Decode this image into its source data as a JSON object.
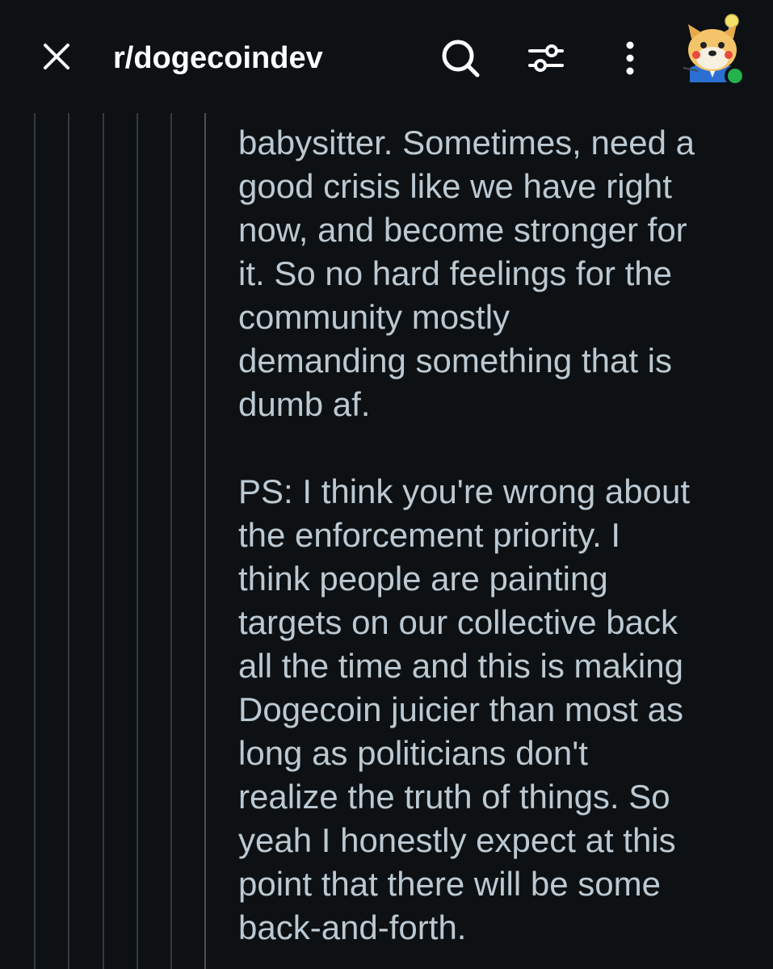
{
  "header": {
    "title": "r/dogecoindev",
    "icons": {
      "close": "close-icon",
      "search": "search-icon",
      "filter": "filter-icon",
      "more": "more-vertical-icon",
      "avatar": "avatar-image"
    },
    "online_status_color": "#24b24d"
  },
  "comment": {
    "paragraphs": [
      "babysitter. Sometimes, need a\ngood crisis like we have right\nnow, and become stronger for\nit. So no hard feelings for the\ncommunity mostly\ndemanding something that is\ndumb af.",
      "PS: I think you're wrong about\nthe enforcement priority. I\nthink people are painting\ntargets on our collective back\nall the time and this is making\nDogecoin juicier than most as\nlong as politicians don't\nrealize the truth of things. So\nyeah I honestly expect at this\npoint that there will be some\nback-and-forth."
    ]
  },
  "colors": {
    "background": "#0d1114",
    "text": "#bcc9d2",
    "title": "#ffffff",
    "thread_line": "#343a3f"
  }
}
